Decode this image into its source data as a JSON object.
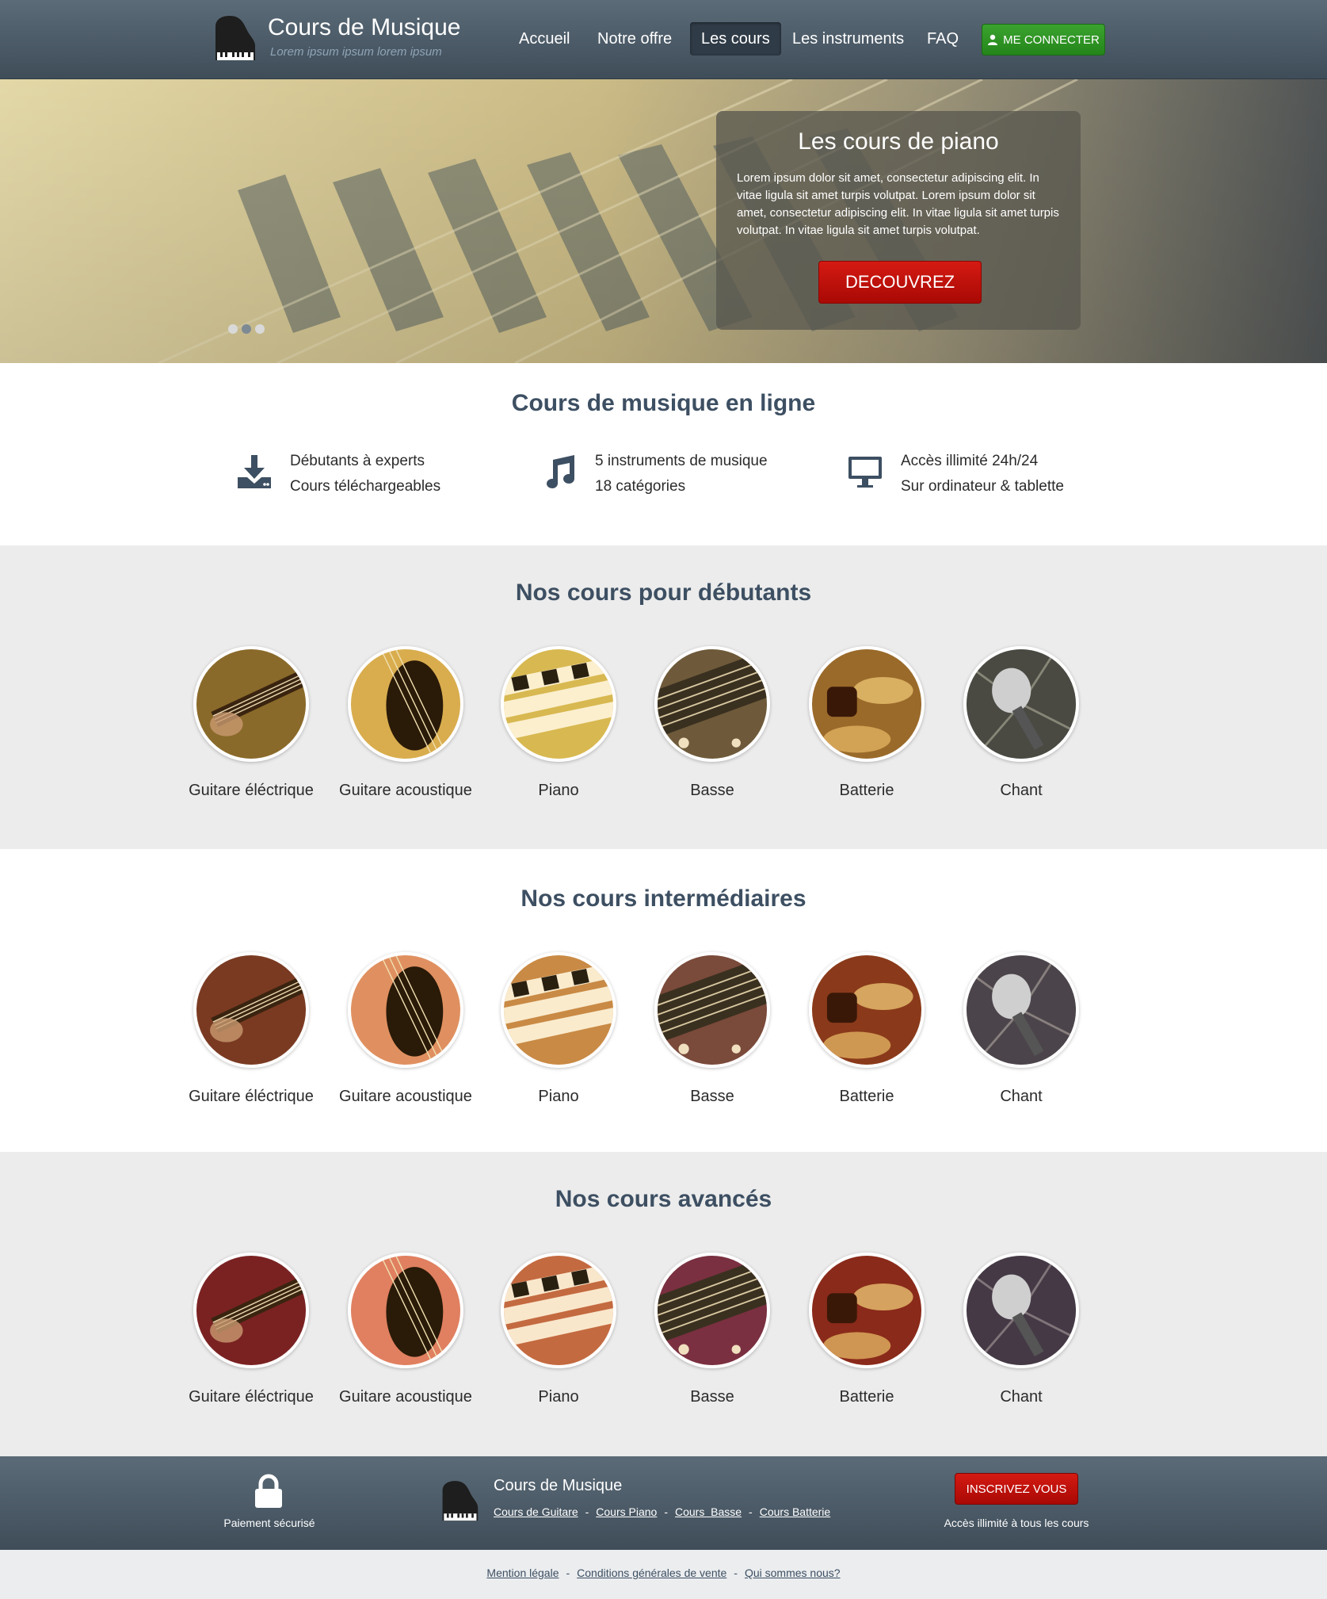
{
  "header": {
    "brand_title": "Cours de Musique",
    "brand_subtitle": "Lorem ipsum ipsum lorem ipsum",
    "nav": [
      {
        "label": "Accueil"
      },
      {
        "label": "Notre offre"
      },
      {
        "label": "Les cours"
      },
      {
        "label": "Les instruments"
      },
      {
        "label": "FAQ"
      }
    ],
    "active_nav": "Les cours",
    "login_label": "ME CONNECTER"
  },
  "hero": {
    "title": "Les cours de piano",
    "text": "Lorem ipsum dolor sit amet, consectetur adipiscing elit. In vitae ligula sit amet turpis volutpat. Lorem ipsum dolor sit amet, consectetur adipiscing elit. In vitae ligula sit amet turpis volutpat. In vitae ligula sit amet turpis volutpat.",
    "button_label": "DECOUVREZ",
    "slides": 3,
    "active_slide": 2
  },
  "online": {
    "title": "Cours de musique en ligne",
    "features": [
      {
        "icon": "download-icon",
        "line1": "Débutants à experts",
        "line2": "Cours téléchargeables"
      },
      {
        "icon": "music-note-icon",
        "line1": "5 instruments de musique",
        "line2": "18 catégories"
      },
      {
        "icon": "desktop-icon",
        "line1": "Accès illimité 24h/24",
        "line2": "Sur ordinateur & tablette"
      }
    ]
  },
  "beginner": {
    "title": "Nos cours pour débutants",
    "courses": [
      "Guitare éléctrique",
      "Guitare acoustique",
      "Piano",
      "Basse",
      "Batterie",
      "Chant"
    ]
  },
  "intermediate": {
    "title": "Nos cours intermédiaires",
    "courses": [
      "Guitare éléctrique",
      "Guitare acoustique",
      "Piano",
      "Basse",
      "Batterie",
      "Chant"
    ]
  },
  "advanced": {
    "title": "Nos cours avancés",
    "courses": [
      "Guitare éléctrique",
      "Guitare acoustique",
      "Piano",
      "Basse",
      "Batterie",
      "Chant"
    ]
  },
  "footer": {
    "secure_payment": "Paiement sécurisé",
    "brand_title": "Cours de Musique",
    "links": [
      "Cours de Guitare",
      "Cours Piano",
      "Cours  Basse",
      "Cours Batterie"
    ],
    "signup_label": "INSCRIVEZ VOUS",
    "signup_caption": "Accès illimité à tous les cours"
  },
  "bottom": {
    "links": [
      "Mention légale",
      "Conditions générales de vente",
      "Qui sommes nous?"
    ]
  },
  "colors": {
    "header_bg": "#4b5a67",
    "login_green": "#2f9a25",
    "cta_red": "#c0100a",
    "section_title": "#3d4f62",
    "band_grey": "#ececec"
  }
}
